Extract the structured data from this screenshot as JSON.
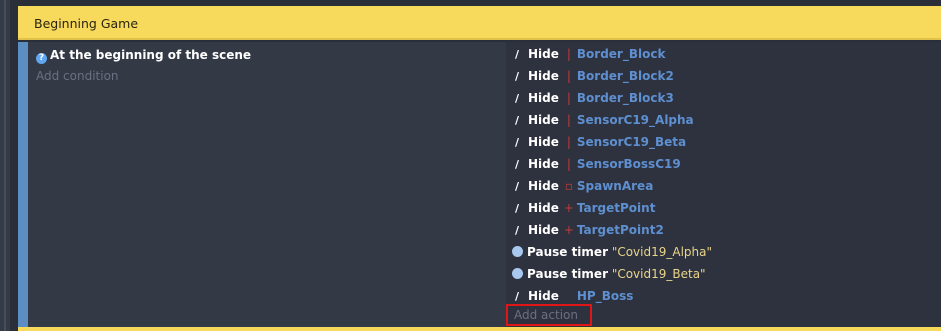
{
  "group": {
    "title": "Beginning Game"
  },
  "event": {
    "condition": {
      "label": "At the beginning of the scene",
      "icon": "scene-start-icon"
    },
    "add_condition_label": "Add condition",
    "actions": [
      {
        "verb": "Hide",
        "icon": "hide-icon",
        "object": "Border_Block"
      },
      {
        "verb": "Hide",
        "icon": "hide-icon",
        "object": "Border_Block2"
      },
      {
        "verb": "Hide",
        "icon": "hide-icon",
        "object": "Border_Block3"
      },
      {
        "verb": "Hide",
        "icon": "hide-icon",
        "object": "SensorC19_Alpha"
      },
      {
        "verb": "Hide",
        "icon": "hide-icon",
        "object": "SensorC19_Beta"
      },
      {
        "verb": "Hide",
        "icon": "hide-icon",
        "object": "SensorBossC19"
      },
      {
        "verb": "Hide",
        "icon": "hide-icon",
        "object": "SpawnArea"
      },
      {
        "verb": "Hide",
        "icon": "hide-icon",
        "object": "TargetPoint"
      },
      {
        "verb": "Hide",
        "icon": "hide-icon",
        "object": "TargetPoint2"
      },
      {
        "verb": "Pause timer",
        "icon": "timer-icon",
        "timer": "\"Covid19_Alpha\""
      },
      {
        "verb": "Pause timer",
        "icon": "timer-icon",
        "timer": "\"Covid19_Beta\""
      },
      {
        "verb": "Hide",
        "icon": "hide-icon",
        "object": "HP_Boss"
      }
    ],
    "add_action_label": "Add action"
  },
  "colors": {
    "group_header": "#f7da5c",
    "object_name": "#5e8fd0",
    "timer_string": "#e9d58a",
    "highlight_box": "#e01616"
  }
}
